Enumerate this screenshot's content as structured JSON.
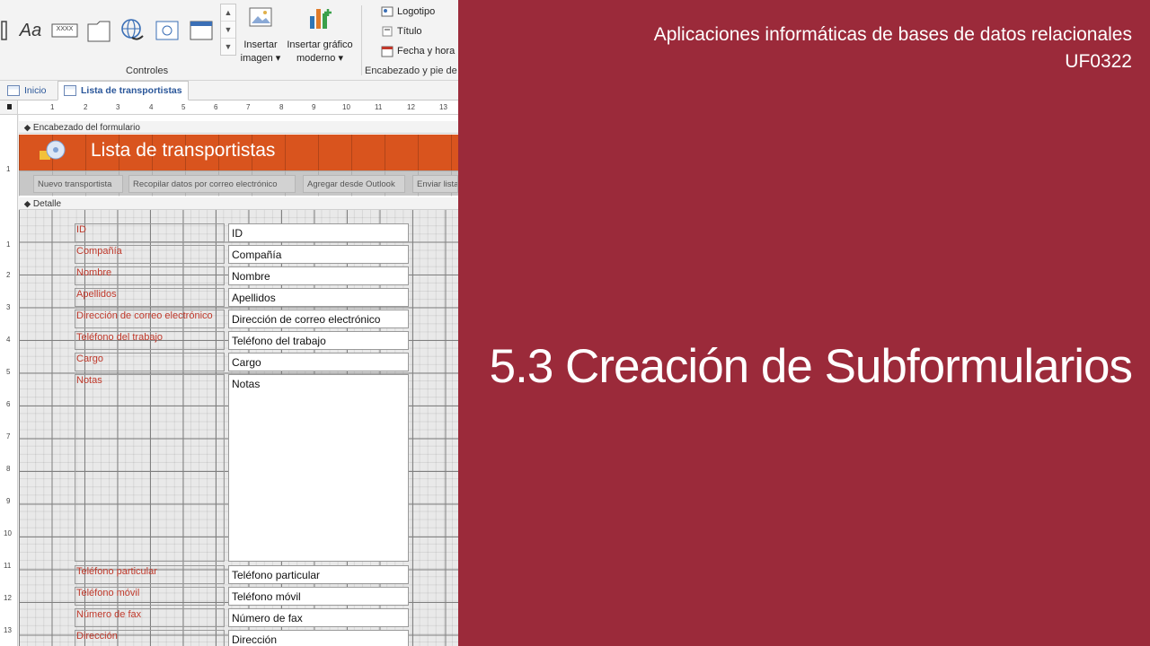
{
  "ribbon": {
    "controls_group_label": "Controles",
    "header_group_label": "Encabezado y pie de",
    "insert_image_label_1": "Insertar",
    "insert_image_label_2": "imagen ▾",
    "insert_chart_label_1": "Insertar gráfico",
    "insert_chart_label_2": "moderno ▾",
    "logo_label": "Logotipo",
    "title_label": "Título",
    "datetime_label": "Fecha y hora",
    "text_icon_glyph": "Aa",
    "field_icon_glyph": "XXXX",
    "gallery_up": "▲",
    "gallery_down": "▼",
    "gallery_more": "▼"
  },
  "tabs": [
    {
      "label": "Inicio",
      "active": false
    },
    {
      "label": "Lista de transportistas",
      "active": true
    }
  ],
  "ruler": {
    "h_numbers": [
      "1",
      "2",
      "3",
      "4",
      "5",
      "6",
      "7",
      "8",
      "9",
      "10",
      "11",
      "12",
      "13"
    ],
    "v_numbers": [
      "1",
      "2",
      "3",
      "4",
      "5",
      "6",
      "7",
      "8",
      "9",
      "10",
      "11",
      "12",
      "13"
    ]
  },
  "form": {
    "header_section_label": "Encabezado del formulario",
    "detail_section_label": "Detalle",
    "title": "Lista de transportistas",
    "header_buttons": [
      "Nuevo transportista",
      "Recopilar datos por correo electrónico",
      "Agregar desde Outlook",
      "Enviar lista"
    ],
    "fields": [
      {
        "label": "ID",
        "value": "ID"
      },
      {
        "label": "Compañía",
        "value": "Compañía"
      },
      {
        "label": "Nombre",
        "value": "Nombre"
      },
      {
        "label": "Apellidos",
        "value": "Apellidos"
      },
      {
        "label": "Dirección de correo electrónico",
        "value": "Dirección de correo electrónico"
      },
      {
        "label": "Teléfono del trabajo",
        "value": "Teléfono del trabajo"
      },
      {
        "label": "Cargo",
        "value": "Cargo"
      },
      {
        "label": "Notas",
        "value": "Notas"
      },
      {
        "label": "Teléfono particular",
        "value": "Teléfono particular"
      },
      {
        "label": "Teléfono móvil",
        "value": "Teléfono móvil"
      },
      {
        "label": "Número de fax",
        "value": "Número de fax"
      },
      {
        "label": "Dirección",
        "value": "Dirección"
      }
    ]
  },
  "slide": {
    "course_line_1": "Aplicaciones informáticas de bases de datos relacionales",
    "course_line_2": "UF0322",
    "headline": "5.3 Creación de Subformularios",
    "background_color": "#9b2a3a",
    "form_header_color": "#d9541e"
  }
}
